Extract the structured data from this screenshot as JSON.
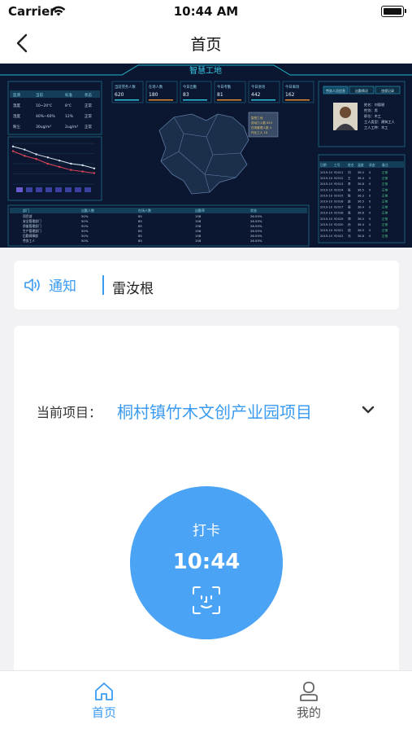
{
  "status_bar": {
    "carrier": "Carrier",
    "time": "10:44 AM"
  },
  "nav": {
    "title": "首页",
    "back_icon": "chevron-left-icon"
  },
  "banner": {
    "title": "智慧工地",
    "map_labels": [
      "智慧工地",
      "劳动力人数 624",
      "在场管理人数 4",
      "作业工人 18"
    ],
    "worker_panel": {
      "tabs": [
        "劳务人员信息",
        "出勤情况",
        "违规记录"
      ],
      "fields": [
        "姓名：刘德根",
        "性别：男",
        "职位：木工",
        "工人类型：建筑工人",
        "工人工种：木工"
      ]
    },
    "stat_cards": [
      {
        "label": "当前劳务人数",
        "value": "620"
      },
      {
        "label": "在场人数",
        "value": "180"
      },
      {
        "label": "今日出勤",
        "value": "83"
      },
      {
        "label": "今日考勤",
        "value": "81"
      },
      {
        "label": "今日进场",
        "value": "442"
      },
      {
        "label": "今日离场",
        "value": "162"
      }
    ],
    "env_table": {
      "headers": [
        "监测",
        "当前",
        "标准",
        "状态"
      ],
      "rows": [
        [
          "温度",
          "10~20℃",
          "8℃",
          "正常"
        ],
        [
          "湿度",
          "40%~60%",
          "12%",
          "正常"
        ],
        [
          "粉尘",
          "30ug/m³",
          "2ug/m³",
          "正常"
        ]
      ]
    },
    "bottom_table": {
      "headers": [
        "部门",
        "出勤人数",
        "在场人数",
        "出勤率",
        "状态"
      ],
      "rows": [
        [
          "项目部",
          "50%",
          "85",
          "158",
          "26.55%"
        ],
        [
          "安全管理部门",
          "50%",
          "85",
          "158",
          "26.55%"
        ],
        [
          "质量管理部门",
          "50%",
          "85",
          "158",
          "26.55%"
        ],
        [
          "生产管理部门",
          "50%",
          "85",
          "158",
          "26.55%"
        ],
        [
          "后勤保障部",
          "50%",
          "85",
          "158",
          "26.55%"
        ],
        [
          "劳务工人",
          "50%",
          "85",
          "158",
          "26.55%"
        ]
      ]
    },
    "right_table": {
      "headers": [
        "日期",
        "工号",
        "姓名",
        "温度",
        "状态",
        "备注"
      ],
      "rows": [
        [
          "2019-10",
          "92011",
          "刘",
          "36.5",
          "0",
          "正常"
        ],
        [
          "2019-10",
          "92012",
          "王",
          "36.4",
          "0",
          "正常"
        ],
        [
          "2019-10",
          "92013",
          "李",
          "36.6",
          "0",
          "正常"
        ],
        [
          "2019-10",
          "92014",
          "张",
          "36.5",
          "0",
          "正常"
        ],
        [
          "2019-10",
          "92015",
          "陈",
          "36.3",
          "0",
          "正常"
        ],
        [
          "2019-10",
          "92016",
          "赵",
          "36.5",
          "0",
          "正常"
        ],
        [
          "2019-10",
          "92017",
          "周",
          "36.4",
          "0",
          "正常"
        ],
        [
          "2019-10",
          "92018",
          "吴",
          "36.6",
          "0",
          "正常"
        ],
        [
          "2019-10",
          "92019",
          "郑",
          "36.5",
          "0",
          "正常"
        ],
        [
          "2019-10",
          "92020",
          "孙",
          "36.4",
          "0",
          "正常"
        ],
        [
          "2019-10",
          "92021",
          "钱",
          "36.5",
          "0",
          "正常"
        ],
        [
          "2019-10",
          "92022",
          "冯",
          "36.6",
          "0",
          "正常"
        ]
      ]
    },
    "line_chart_values": [
      2.1,
      1.8,
      1.6,
      1.3,
      1.1,
      0.9,
      0.8,
      0.7
    ],
    "line_chart_values2": [
      2.4,
      2.2,
      1.9,
      1.7,
      1.5,
      1.3,
      1.2,
      1.0
    ]
  },
  "notice": {
    "label": "通知",
    "text": "雷汝根",
    "icon": "speaker-icon"
  },
  "project": {
    "label": "当前项目：",
    "name": "桐村镇竹木文创产业园项目",
    "chevron": "chevron-down-icon"
  },
  "clock_in": {
    "label": "打卡",
    "time": "10:44",
    "icon": "face-scan-icon"
  },
  "tabs": [
    {
      "label": "首页",
      "icon": "home-icon",
      "active": true
    },
    {
      "label": "我的",
      "icon": "user-icon",
      "active": false
    }
  ],
  "colors": {
    "accent": "#3b9bf0",
    "clock_button": "#4aa3f5",
    "banner_bg": "#0b1730"
  }
}
